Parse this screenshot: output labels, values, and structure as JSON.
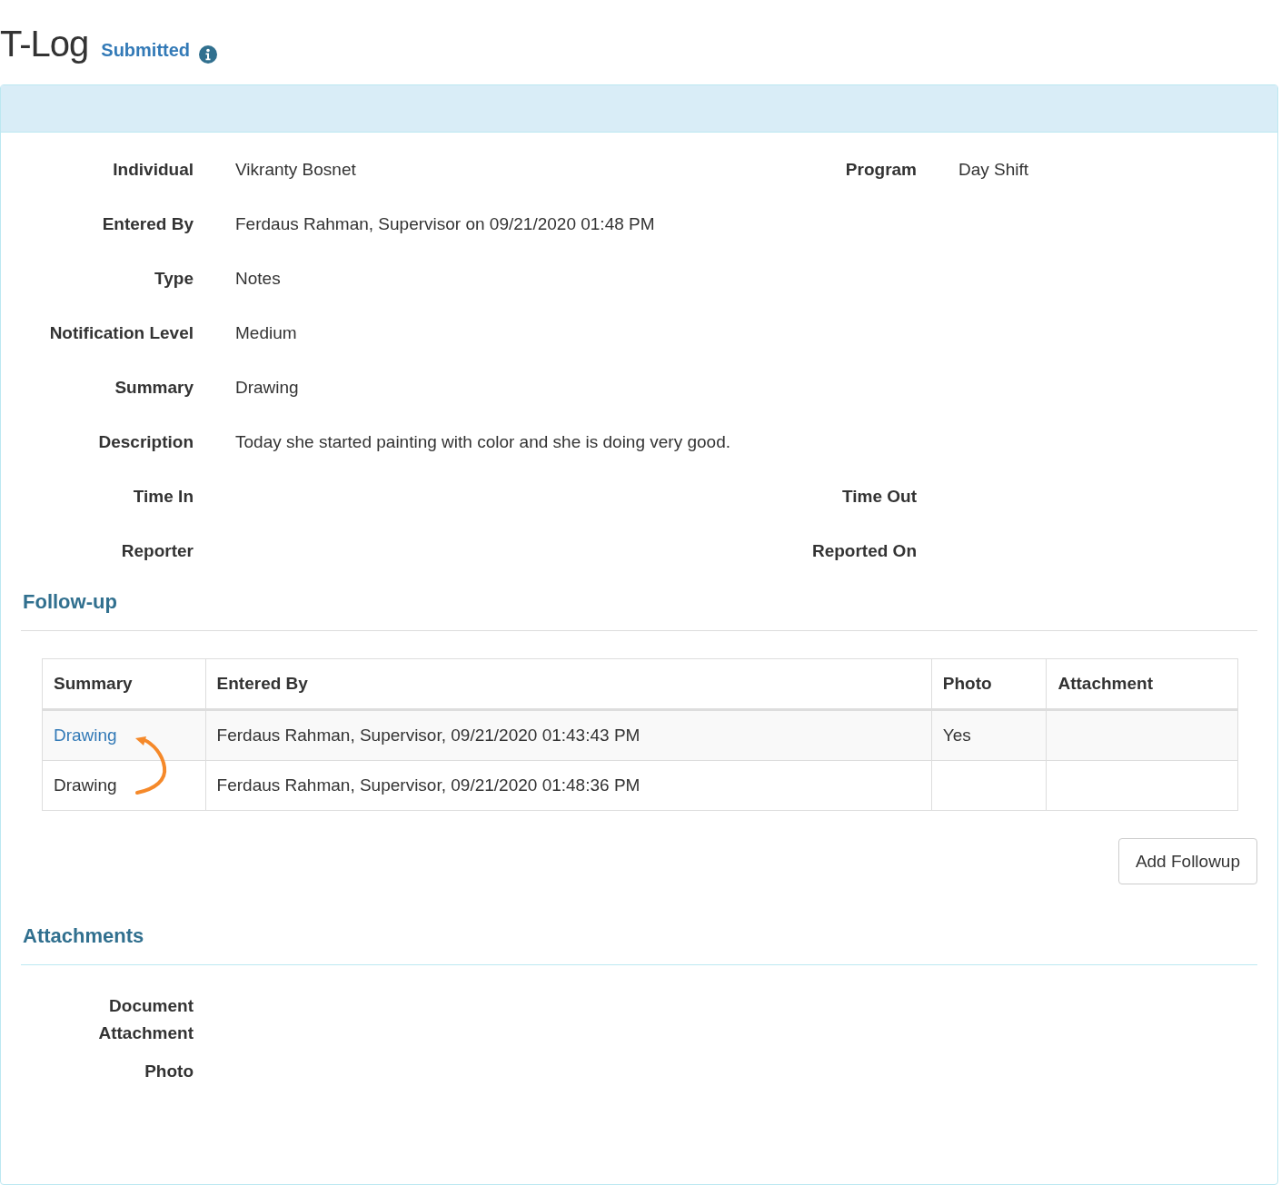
{
  "page": {
    "title": "T-Log",
    "status": "Submitted"
  },
  "details": [
    {
      "pairs": [
        {
          "label": "Individual",
          "value": "Vikranty Bosnet"
        },
        {
          "label": "Program",
          "value": "Day Shift"
        }
      ]
    },
    {
      "pairs": [
        {
          "label": "Entered By",
          "value": "Ferdaus Rahman, Supervisor on 09/21/2020 01:48 PM"
        }
      ]
    },
    {
      "pairs": [
        {
          "label": "Type",
          "value": "Notes"
        }
      ]
    },
    {
      "pairs": [
        {
          "label": "Notification Level",
          "value": "Medium"
        }
      ]
    },
    {
      "pairs": [
        {
          "label": "Summary",
          "value": "Drawing"
        }
      ]
    },
    {
      "pairs": [
        {
          "label": "Description",
          "value": "Today she started painting with color and she is doing very good."
        }
      ]
    },
    {
      "pairs": [
        {
          "label": "Time In"
        },
        {
          "label": "Time Out"
        }
      ]
    },
    {
      "pairs": [
        {
          "label": "Reporter"
        },
        {
          "label": "Reported On"
        }
      ]
    }
  ],
  "followup": {
    "heading": "Follow-up",
    "columns": [
      "Summary",
      "Entered By",
      "Photo",
      "Attachment"
    ],
    "rows": [
      {
        "summary": "Drawing",
        "link": true,
        "entered_by": "Ferdaus Rahman, Supervisor, 09/21/2020 01:43:43 PM",
        "photo": "Yes"
      },
      {
        "summary": "Drawing",
        "link": false,
        "entered_by": "Ferdaus Rahman, Supervisor, 09/21/2020 01:48:36 PM"
      }
    ],
    "button": "Add Followup"
  },
  "attachments": {
    "heading": "Attachments",
    "fields": [
      {
        "label": "Document Attachment"
      },
      {
        "label": "Photo"
      }
    ]
  }
}
